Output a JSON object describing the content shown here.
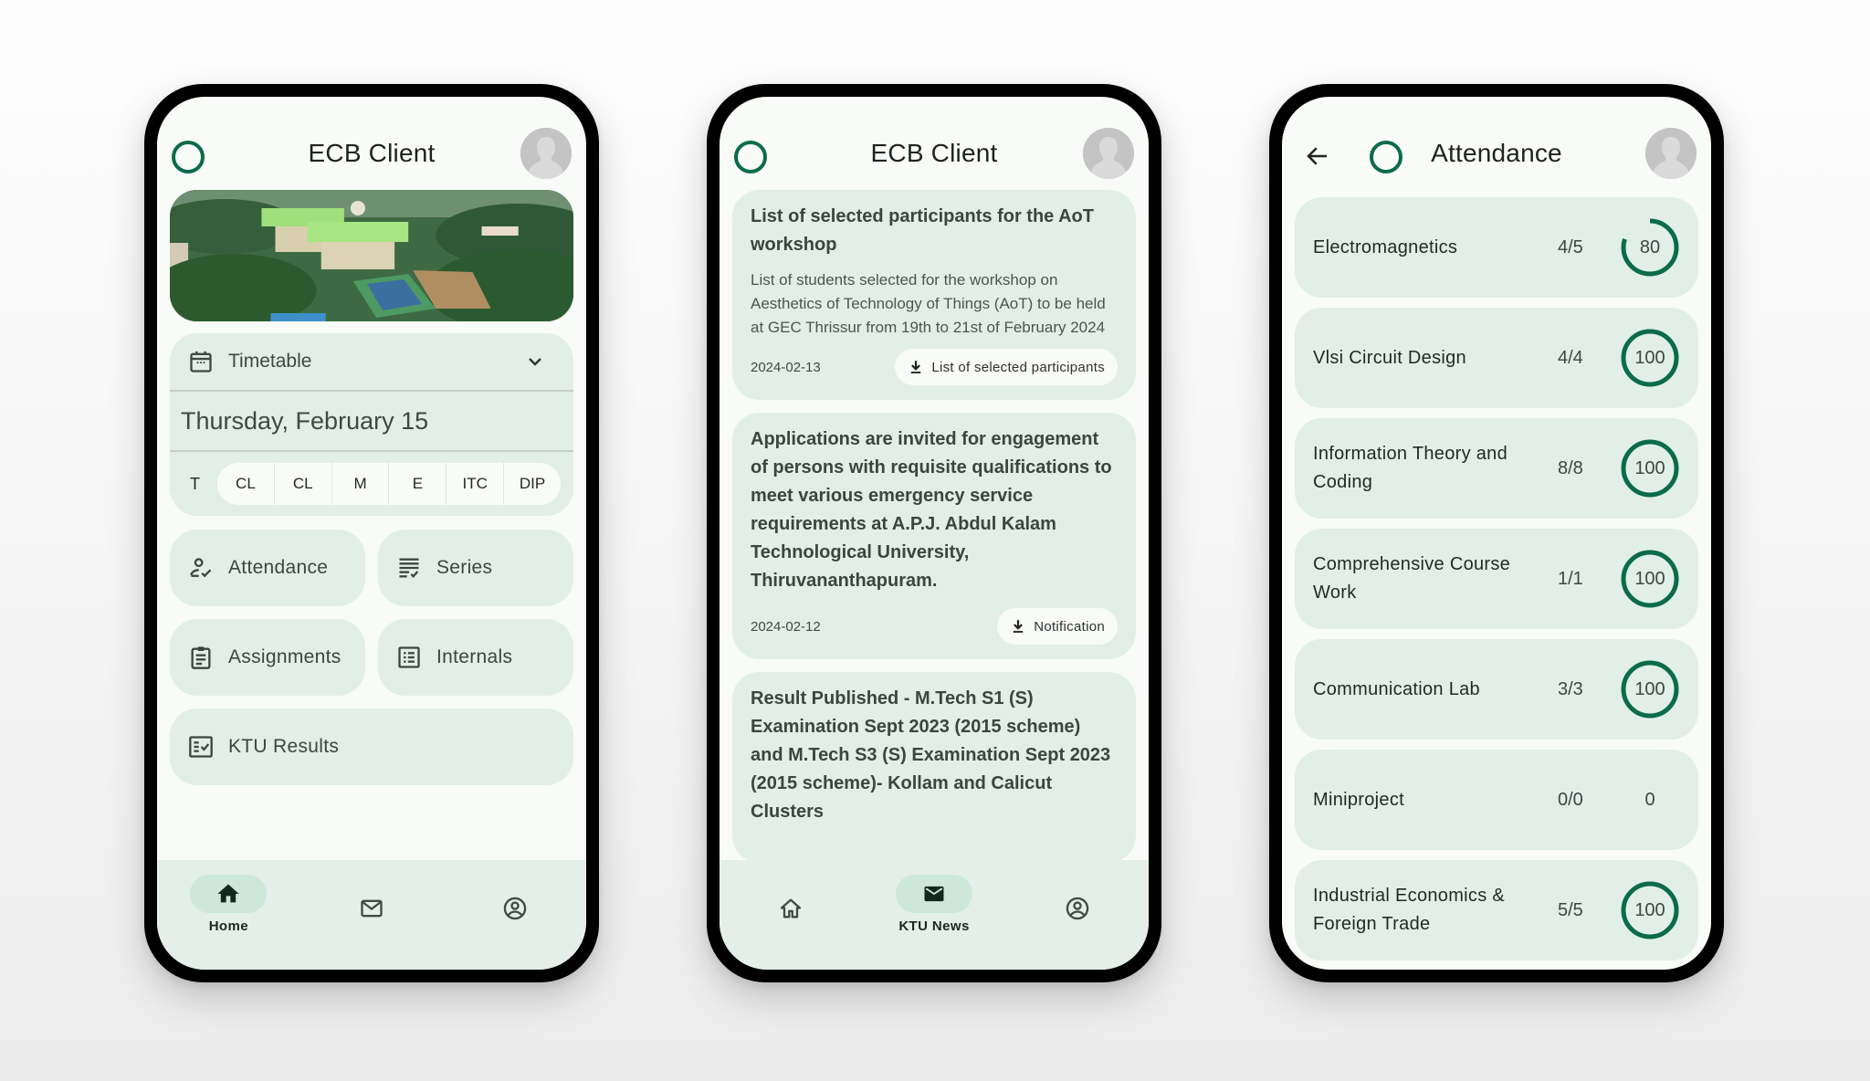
{
  "colors": {
    "accent": "#0b6b4a",
    "card_bg": "#e2efe8",
    "screen_bg": "#f8fbf7",
    "nav_active_pill": "#cde8d9"
  },
  "home": {
    "header": {
      "title": "ECB Client",
      "logo_icon": "ring-logo-icon",
      "avatar_icon": "avatar-placeholder-icon"
    },
    "banner": {
      "alt": "Aerial view of college campus"
    },
    "timetable": {
      "label": "Timetable",
      "icon": "calendar-icon",
      "expand_icon": "chevron-down-icon",
      "date": "Thursday, February 15",
      "current_period": "T",
      "periods": [
        "CL",
        "CL",
        "M",
        "E",
        "ITC",
        "DIP"
      ]
    },
    "buttons": [
      {
        "label": "Attendance",
        "icon": "person-check-icon"
      },
      {
        "label": "Series",
        "icon": "list-check-icon"
      },
      {
        "label": "Assignments",
        "icon": "clipboard-icon"
      },
      {
        "label": "Internals",
        "icon": "list-box-icon"
      },
      {
        "label": "KTU Results",
        "icon": "checklist-box-icon"
      }
    ],
    "bottom_nav": {
      "items": [
        {
          "label": "Home",
          "icon": "home-icon",
          "active": true
        },
        {
          "label": "KTU News",
          "icon": "mail-icon",
          "active": false
        },
        {
          "label": "Profile",
          "icon": "account-circle-icon",
          "active": false
        }
      ]
    }
  },
  "news": {
    "header": {
      "title": "ECB Client"
    },
    "items": [
      {
        "title": "List of selected participants for the AoT workshop",
        "description": "List of students selected for the workshop on Aesthetics of Technology of Things (AoT) to be held at GEC Thrissur from 19th to 21st of February 2024",
        "date": "2024-02-13",
        "link_label": "List of selected participants"
      },
      {
        "title": "Applications are invited for engagement of persons with requisite qualifications to meet various emergency service requirements at A.P.J. Abdul Kalam Technological University, Thiruvananthapuram.",
        "description": "",
        "date": "2024-02-12",
        "link_label": "Notification"
      },
      {
        "title": "Result Published - M.Tech S1 (S) Examination Sept 2023 (2015 scheme) and M.Tech S3 (S) Examination Sept 2023 (2015 scheme)- Kollam and Calicut Clusters",
        "description": "",
        "date": "",
        "link_label": ""
      }
    ],
    "bottom_nav": {
      "items": [
        {
          "label": "Home",
          "icon": "home-outline-icon",
          "active": false
        },
        {
          "label": "KTU News",
          "icon": "mail-filled-icon",
          "active": true
        },
        {
          "label": "Profile",
          "icon": "account-circle-icon",
          "active": false
        }
      ]
    }
  },
  "attendance": {
    "header": {
      "title": "Attendance",
      "back_icon": "arrow-back-icon"
    },
    "subjects": [
      {
        "name": "Electromagnetics",
        "ratio": "4/5",
        "percent": 80
      },
      {
        "name": "Vlsi Circuit Design",
        "ratio": "4/4",
        "percent": 100
      },
      {
        "name": "Information Theory and Coding",
        "ratio": "8/8",
        "percent": 100
      },
      {
        "name": "Comprehensive Course Work",
        "ratio": "1/1",
        "percent": 100
      },
      {
        "name": "Communication Lab",
        "ratio": "3/3",
        "percent": 100
      },
      {
        "name": "Miniproject",
        "ratio": "0/0",
        "percent": 0
      },
      {
        "name": "Industrial Economics & Foreign Trade",
        "ratio": "5/5",
        "percent": 100
      }
    ]
  }
}
